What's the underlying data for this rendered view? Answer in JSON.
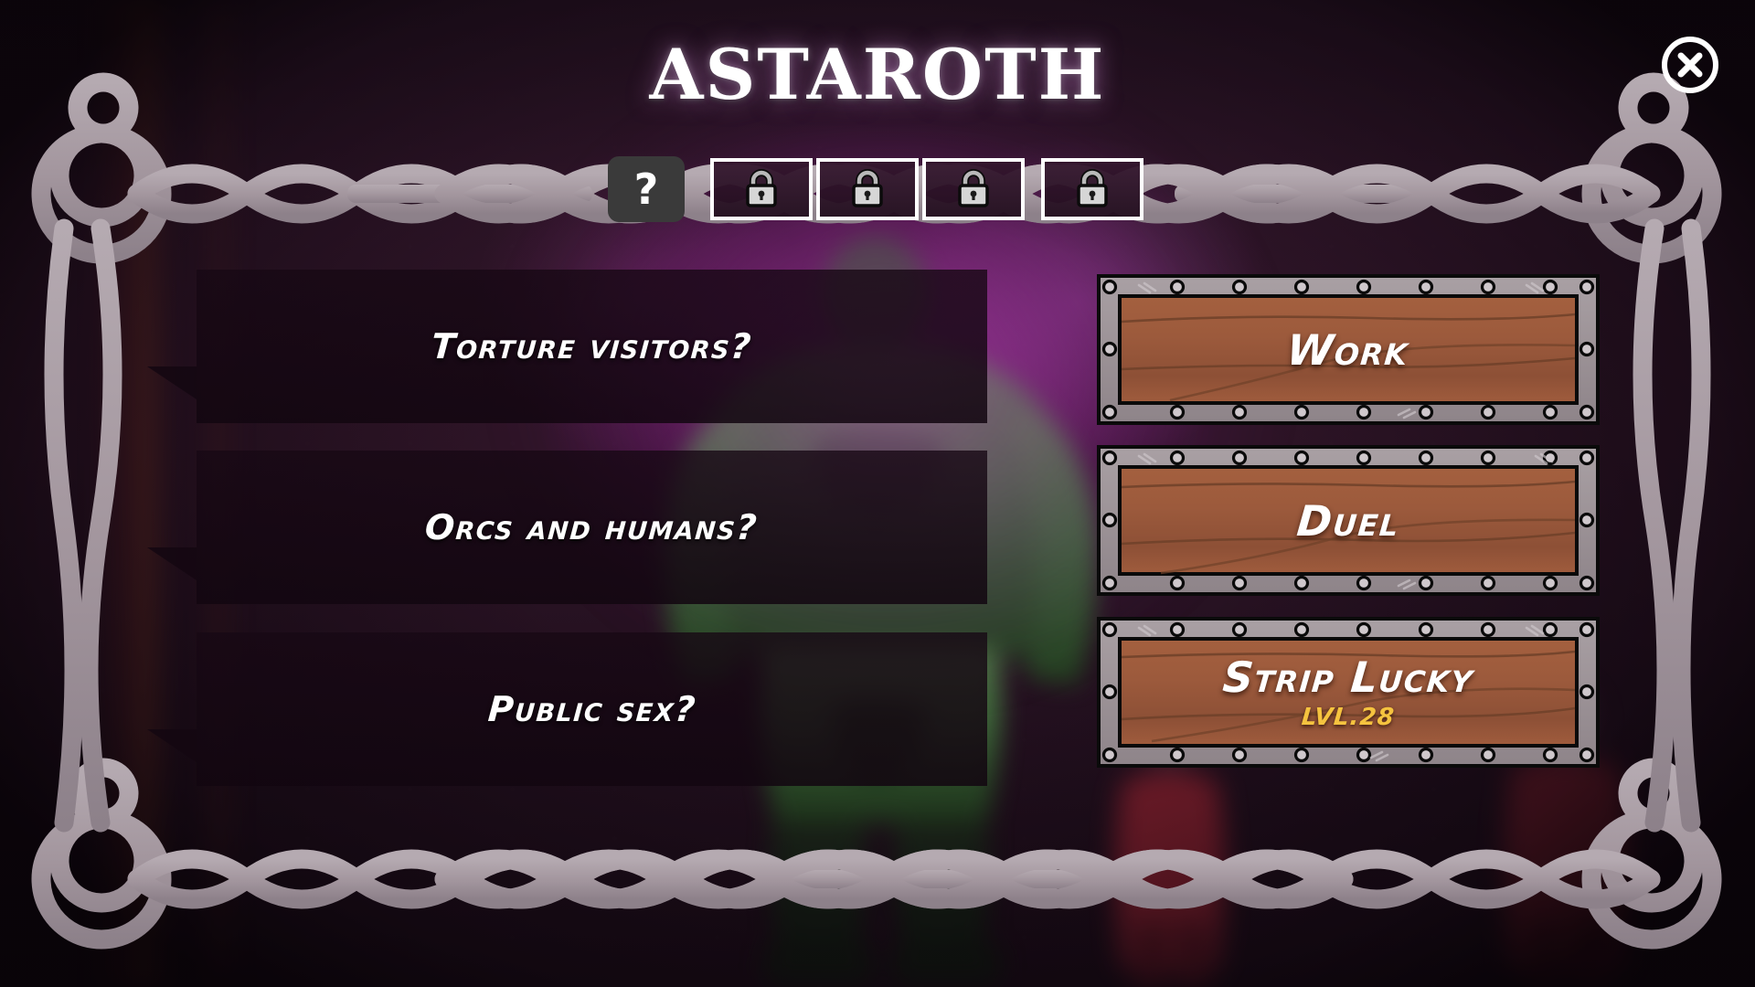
{
  "window": {
    "title": "ASTAROTH",
    "close_icon": "close-circle-icon"
  },
  "progress": {
    "unknown_marker": "?",
    "unknown_icon": "question-mark-icon",
    "slots": [
      {
        "state": "locked",
        "icon": "padlock-icon"
      },
      {
        "state": "locked",
        "icon": "padlock-icon"
      },
      {
        "state": "locked",
        "icon": "padlock-icon"
      },
      {
        "state": "locked",
        "icon": "padlock-icon"
      }
    ]
  },
  "dialogue_options": [
    {
      "label": "Torture visitors?"
    },
    {
      "label": "Orcs and humans?"
    },
    {
      "label": "Public sex?"
    }
  ],
  "actions": [
    {
      "label": "Work",
      "sub": ""
    },
    {
      "label": "Duel",
      "sub": ""
    },
    {
      "label": "Strip Lucky",
      "sub": "LVL.28"
    }
  ],
  "colors": {
    "accent_gold": "#f5c33f",
    "wood": "#9c5a3c",
    "wood_dark": "#7d4530",
    "metal_frame": "#9b9195",
    "rope": "#a79ba3",
    "panel_bg": "#170814",
    "backdrop": "#2a1426",
    "text_white": "#ffffff",
    "qbox_bg": "#3a3a3a"
  }
}
